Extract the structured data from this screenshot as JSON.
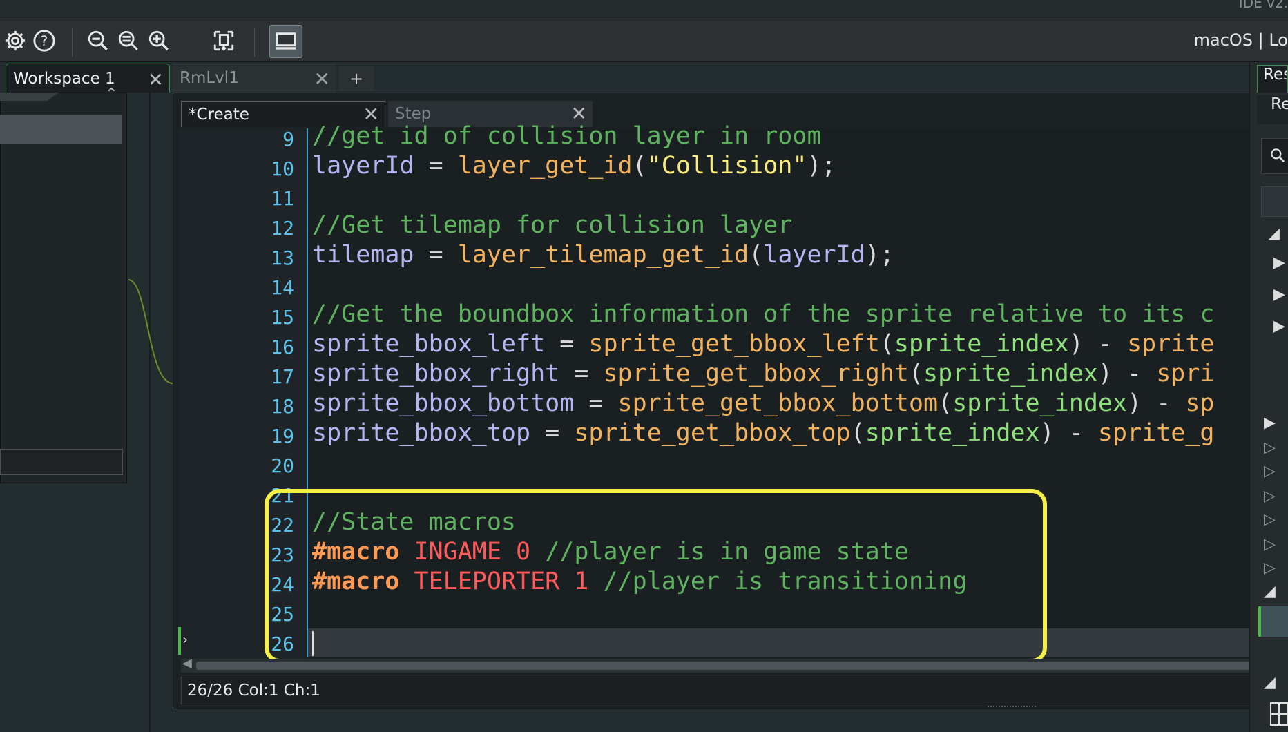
{
  "window": {
    "title": "IDE v2.",
    "platform": "macOS | Lo"
  },
  "toolbar": {
    "icons": [
      "gear-icon",
      "help-icon",
      "zoom-out-icon",
      "zoom-reset-icon",
      "zoom-in-icon",
      "fit-view-icon",
      "monitor-icon"
    ]
  },
  "workspace_tabs": [
    {
      "label": "Workspace 1",
      "active": true
    },
    {
      "label": "RmLvl1",
      "active": false
    }
  ],
  "add_tab_label": "+",
  "editor": {
    "tabs": [
      {
        "label": "*Create",
        "active": true
      },
      {
        "label": "Step",
        "active": false
      }
    ],
    "status": "26/26 Col:1 Ch:1",
    "line_numbers": [
      "9",
      "10",
      "11",
      "12",
      "13",
      "14",
      "15",
      "16",
      "17",
      "18",
      "19",
      "20",
      "21",
      "22",
      "23",
      "24",
      "25",
      "26"
    ],
    "lines": {
      "l9": {
        "comment": "//get id of collision layer in room"
      },
      "l10": {
        "var": "layerId",
        "eq": " = ",
        "fn": "layer_get_id",
        "open": "(",
        "str": "\"Collision\"",
        "close": ");"
      },
      "l12": {
        "comment": "//Get tilemap for collision layer"
      },
      "l13": {
        "var": "tilemap",
        "eq": " = ",
        "fn": "layer_tilemap_get_id",
        "open": "(",
        "arg": "layerId",
        "close": ");"
      },
      "l15": {
        "comment": "//Get the boundbox information of the sprite relative to its c"
      },
      "l16": {
        "var": "sprite_bbox_left",
        "eq": " = ",
        "fn": "sprite_get_bbox_left",
        "open": "(",
        "arg": "sprite_index",
        "close": ") - ",
        "tail": "sprite"
      },
      "l17": {
        "var": "sprite_bbox_right",
        "eq": " = ",
        "fn": "sprite_get_bbox_right",
        "open": "(",
        "arg": "sprite_index",
        "close": ") - ",
        "tail": "spri"
      },
      "l18": {
        "var": "sprite_bbox_bottom",
        "eq": " = ",
        "fn": "sprite_get_bbox_bottom",
        "open": "(",
        "arg": "sprite_index",
        "close": ") - ",
        "tail": "sp"
      },
      "l19": {
        "var": "sprite_bbox_top",
        "eq": " = ",
        "fn": "sprite_get_bbox_top",
        "open": "(",
        "arg": "sprite_index",
        "close": ") - ",
        "tail": "sprite_g"
      },
      "l22": {
        "comment": "//State macros"
      },
      "l23": {
        "kw": "#macro",
        "name": "INGAME",
        "val": "0",
        "comment": "//player is in game state"
      },
      "l24": {
        "kw": "#macro",
        "name": "TELEPORTER",
        "val": "1",
        "comment": "//player is transitioning"
      }
    }
  },
  "right_panel": {
    "tab_label": "Res",
    "sub_label": "Re"
  },
  "colors": {
    "highlight": "#f6f046",
    "comment": "#5fb25f",
    "variable": "#b6b5f4",
    "function": "#f2b25d",
    "string": "#f9ec7d",
    "builtin": "#8ee07a",
    "macro_keyword": "#ff9a55",
    "macro_name": "#ff5a5a",
    "line_number": "#5ec3ea"
  }
}
